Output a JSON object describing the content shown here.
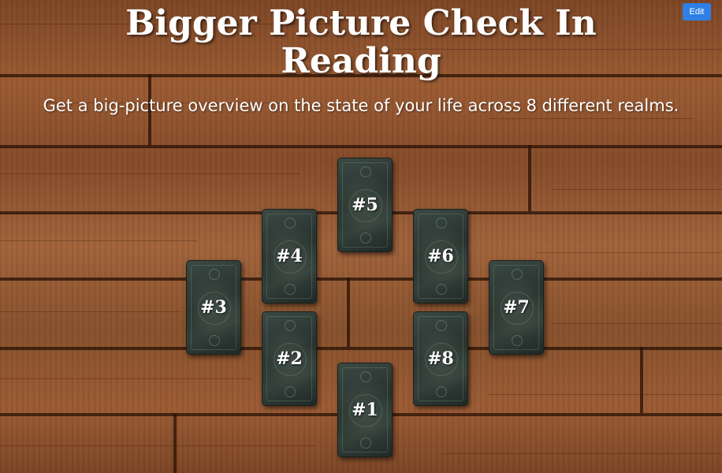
{
  "header": {
    "title": "Bigger Picture Check In Reading",
    "subtitle": "Get a big-picture overview on the state of your life across 8 different realms.",
    "edit_label": "Edit"
  },
  "cards": [
    {
      "label": "#5"
    },
    {
      "label": "#4"
    },
    {
      "label": "#6"
    },
    {
      "label": "#3"
    },
    {
      "label": "#7"
    },
    {
      "label": "#2"
    },
    {
      "label": "#8"
    },
    {
      "label": "#1"
    }
  ],
  "colors": {
    "edit_button": "#2f7fe6",
    "card_back": "#2c3733",
    "background_wood": "#8a4f2a"
  }
}
